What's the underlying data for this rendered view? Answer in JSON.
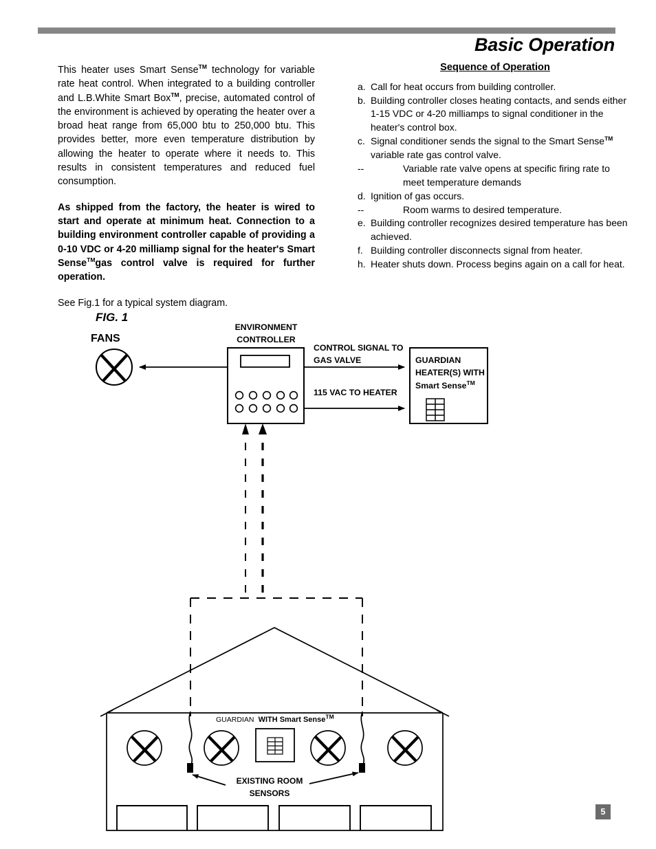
{
  "document": {
    "title": "Basic Operation",
    "page_number": "5",
    "rule_color": "#878787",
    "page_badge_color": "#6b6b6b"
  },
  "left_column": {
    "intro_paragraph_parts": [
      "This heater uses Smart Sense",
      " technology for variable rate heat control.  When integrated to a building controller and L.B.White Smart Box",
      ", precise, automated control of the environment is achieved by operating the heater over a broad heat range from 65,000 btu to 250,000 btu. This provides better, more even temperature distribution by allowing the heater to operate where it needs to. This results in consistent temperatures and reduced fuel consumption."
    ],
    "bold_paragraph_parts": [
      "As shipped from the factory, the heater is wired to start and operate at minimum heat.  Connection to a building environment controller capable of providing a 0-10 VDC or 4-20 milliamp signal for the heater's Smart Sense",
      "gas control valve is required for further operation."
    ],
    "see_fig": "See Fig.1 for a typical system diagram.",
    "tm": "TM"
  },
  "right_column": {
    "heading": "Sequence of Operation",
    "items": [
      {
        "marker": "a.",
        "text": "Call for heat occurs from building controller.",
        "kind": "main"
      },
      {
        "marker": "b.",
        "text": "Building controller closes heating contacts, and sends either 1-15 VDC or 4-20 milliamps to signal conditioner in the heater's control box.",
        "kind": "main"
      },
      {
        "marker": "c.",
        "text_before": "Signal conditioner sends the signal to the Smart Sense",
        "text_after": " variable rate gas control valve.",
        "kind": "main-tm"
      },
      {
        "marker": "--",
        "text": "Variable rate valve opens at specific firing rate to meet temperature demands",
        "kind": "sub"
      },
      {
        "marker": "d.",
        "text": "Ignition of gas occurs.",
        "kind": "main"
      },
      {
        "marker": "--",
        "text": "Room warms to desired temperature.",
        "kind": "sub"
      },
      {
        "marker": "e.",
        "text": "Building controller recognizes desired temperature has been achieved.",
        "kind": "main"
      },
      {
        "marker": "f.",
        "text": "Building controller disconnects signal from heater.",
        "kind": "main"
      },
      {
        "marker": "h.",
        "text": "Heater shuts down. Process begins again on a call for heat.",
        "kind": "main"
      }
    ],
    "tm": "TM"
  },
  "figure": {
    "fig_label": "FIG. 1",
    "fans_label": "FANS",
    "environment_controller_label_line1": "ENVIRONMENT",
    "environment_controller_label_line2": "CONTROLLER",
    "control_signal_label_line1": "CONTROL SIGNAL TO",
    "control_signal_label_line2": "GAS VALVE",
    "vac_label": "115 VAC TO HEATER",
    "guardian_box_line1": "GUARDIAN",
    "guardian_box_line2": "HEATER(S) WITH",
    "guardian_box_line3": "Smart Sense",
    "building_heater_label_a": "GUARDIAN",
    "building_heater_label_b": "WITH Smart Sense",
    "sensors_label_line1": "EXISTING ROOM",
    "sensors_label_line2": "SENSORS",
    "tm": "TM"
  }
}
